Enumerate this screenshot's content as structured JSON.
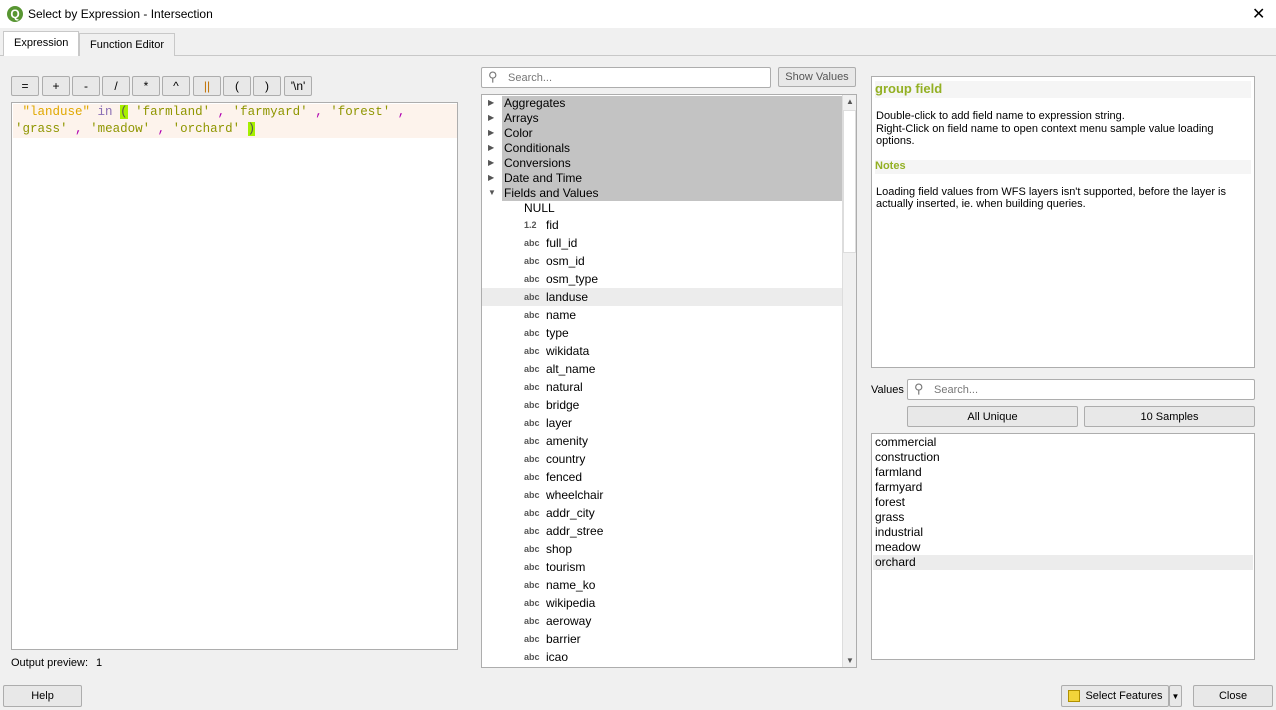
{
  "window": {
    "title": "Select by Expression - Intersection",
    "close": "✕"
  },
  "tabs": [
    {
      "label": "Expression"
    },
    {
      "label": "Function Editor"
    }
  ],
  "operators": [
    "=",
    "+",
    "-",
    "/",
    "*",
    "^",
    "||",
    "(",
    ")",
    "'\\n'"
  ],
  "expression": {
    "field": "\"landuse\"",
    "keyword": "in",
    "open": "(",
    "values": [
      "'farmland'",
      "'farmyard'",
      "'forest'",
      "'grass'",
      "'meadow'",
      "'orchard'"
    ],
    "close": ")"
  },
  "output_preview": {
    "label": "Output preview:",
    "value": "1"
  },
  "function_search": {
    "placeholder": "Search...",
    "show_values": "Show Values"
  },
  "groups": [
    "Aggregates",
    "Arrays",
    "Color",
    "Conditionals",
    "Conversions",
    "Date and Time",
    "Fields and Values"
  ],
  "fields": [
    {
      "type": "",
      "name": "NULL"
    },
    {
      "type": "1.2",
      "name": "fid"
    },
    {
      "type": "abc",
      "name": "full_id"
    },
    {
      "type": "abc",
      "name": "osm_id"
    },
    {
      "type": "abc",
      "name": "osm_type"
    },
    {
      "type": "abc",
      "name": "landuse",
      "selected": true
    },
    {
      "type": "abc",
      "name": "name"
    },
    {
      "type": "abc",
      "name": "type"
    },
    {
      "type": "abc",
      "name": "wikidata"
    },
    {
      "type": "abc",
      "name": "alt_name"
    },
    {
      "type": "abc",
      "name": "natural"
    },
    {
      "type": "abc",
      "name": "bridge"
    },
    {
      "type": "abc",
      "name": "layer"
    },
    {
      "type": "abc",
      "name": "amenity"
    },
    {
      "type": "abc",
      "name": "country"
    },
    {
      "type": "abc",
      "name": "fenced"
    },
    {
      "type": "abc",
      "name": "wheelchair"
    },
    {
      "type": "abc",
      "name": "addr_city"
    },
    {
      "type": "abc",
      "name": "addr_stree"
    },
    {
      "type": "abc",
      "name": "shop"
    },
    {
      "type": "abc",
      "name": "tourism"
    },
    {
      "type": "abc",
      "name": "name_ko"
    },
    {
      "type": "abc",
      "name": "wikipedia"
    },
    {
      "type": "abc",
      "name": "aeroway"
    },
    {
      "type": "abc",
      "name": "barrier"
    },
    {
      "type": "abc",
      "name": "icao"
    }
  ],
  "help": {
    "title": "group field",
    "text1": "Double-click to add field name to expression string.",
    "text2": "Right-Click on field name to open context menu sample value loading options.",
    "notes_title": "Notes",
    "notes": "Loading field values from WFS layers isn't supported, before the layer is actually inserted, ie. when building queries."
  },
  "values": {
    "label": "Values",
    "placeholder": "Search...",
    "all_unique": "All Unique",
    "samples": "10 Samples",
    "items": [
      "commercial",
      "construction",
      "farmland",
      "farmyard",
      "forest",
      "grass",
      "industrial",
      "meadow",
      "orchard"
    ],
    "selected": "orchard"
  },
  "footer": {
    "help": "Help",
    "select_features": "Select Features",
    "close": "Close"
  },
  "colors": {
    "accent": "#93b023",
    "highlight_bracket": "#a7f000",
    "group_bg": "#c3c3c3"
  }
}
